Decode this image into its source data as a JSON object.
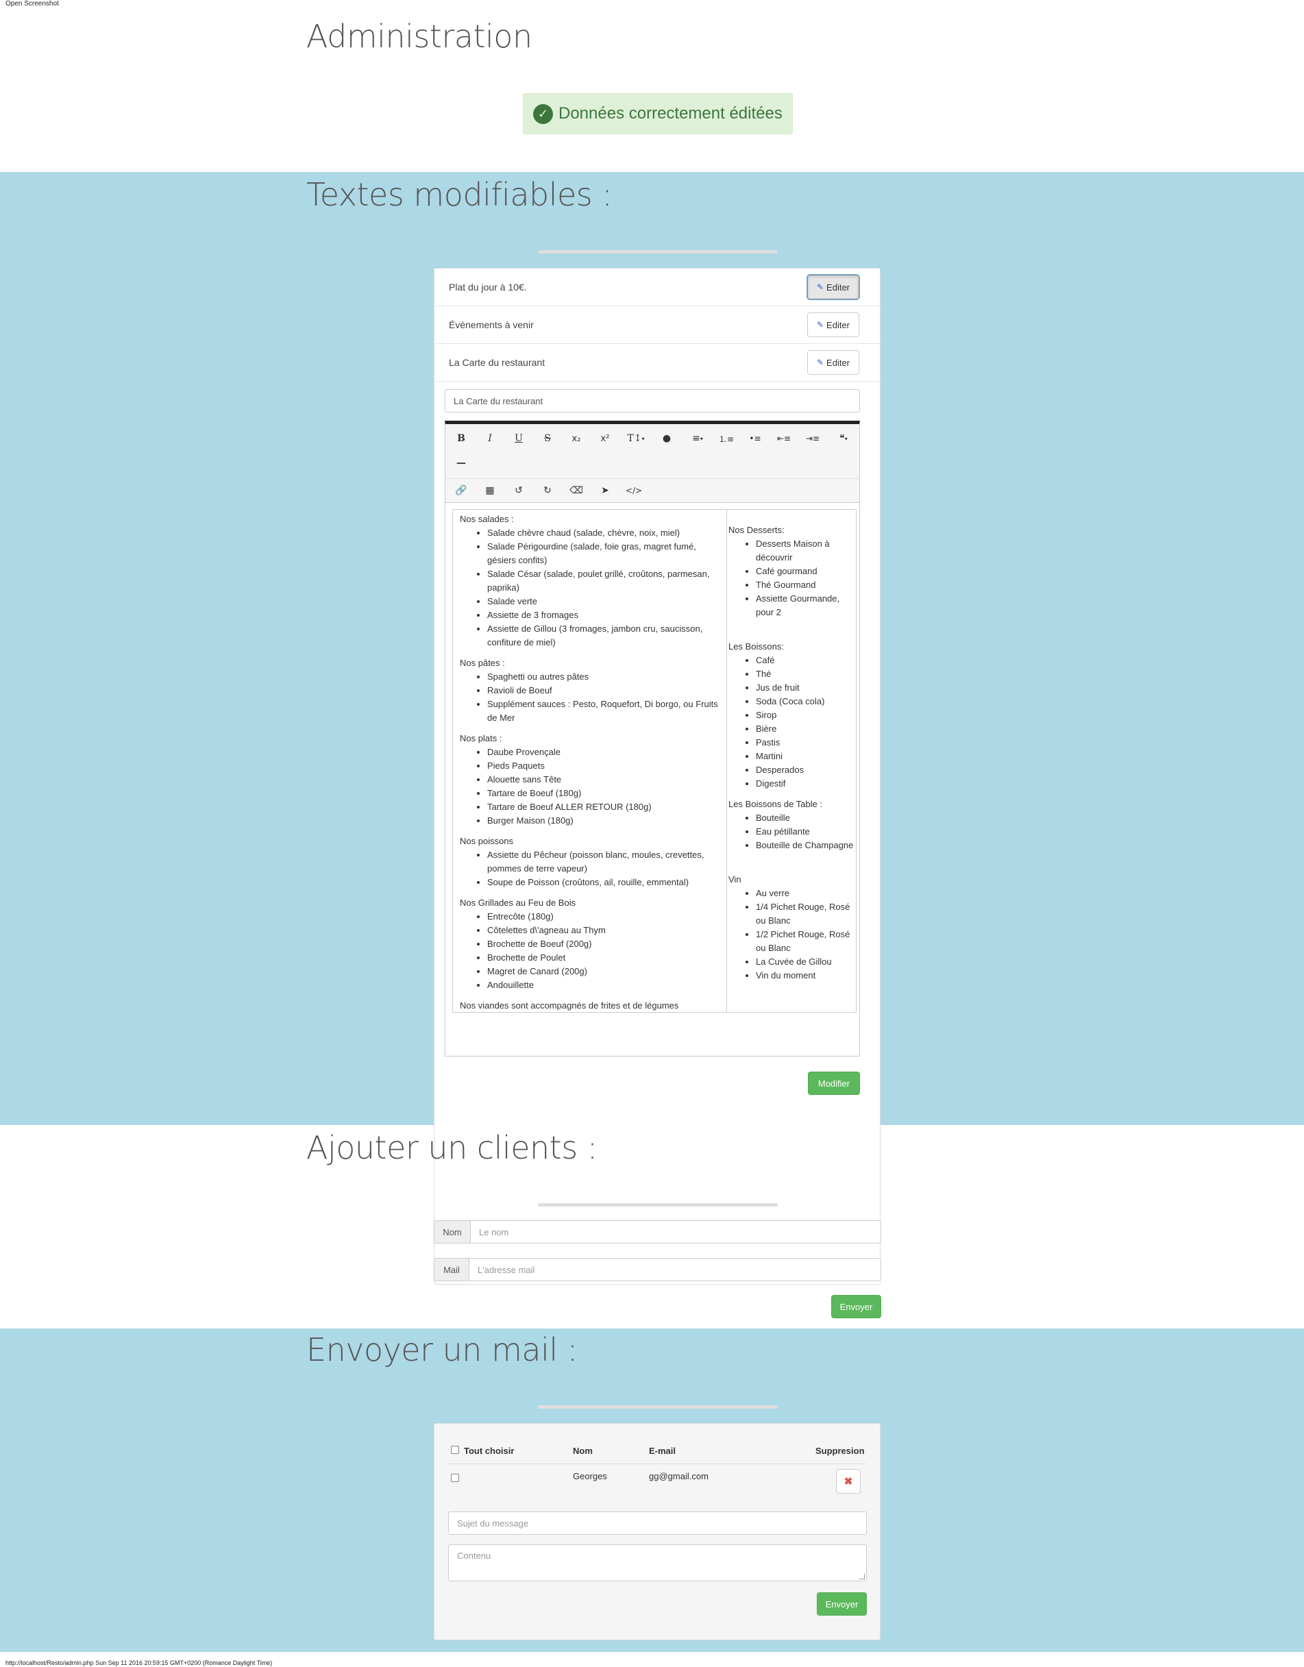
{
  "window": {
    "screenshot_label": "Open Screenshot",
    "footer_url": "http://localhost/Resto/admin.php Sun Sep 11 2016 20:59:15 GMT+0200 (Romance Daylight Time)"
  },
  "header": {
    "title": "Administration"
  },
  "alert": {
    "message": "Données correctement éditées",
    "color": "#3c763d"
  },
  "texts_section": {
    "title": "Textes modifiables :",
    "items": [
      {
        "label": "Plat du jour à 10€.",
        "button": "Editer"
      },
      {
        "label": "Évènements à venir",
        "button": "Editer"
      },
      {
        "label": "La Carte du restaurant",
        "button": "Editer"
      }
    ],
    "title_input_value": "La Carte du restaurant",
    "toolbar": {
      "bold": "B",
      "italic": "I",
      "underline": "U",
      "strike": "S",
      "subscript": "x₂",
      "superscript": "x²",
      "fontsize": "T↕",
      "quote": "❝"
    },
    "menu": {
      "left": [
        {
          "heading": "Nos salades :",
          "items": [
            "Salade chèvre chaud (salade, chèvre, noix, miel)",
            "Salade Périgourdine (salade, foie gras, magret fumé, gésiers confits)",
            "Salade César (salade, poulet grillé, croûtons, parmesan, paprika)",
            "Salade verte",
            "Assiette de 3 fromages",
            "Assiette de Gillou (3 fromages, jambon cru, saucisson, confiture de miel)"
          ]
        },
        {
          "heading": "Nos pâtes :",
          "items": [
            "Spaghetti ou autres pâtes",
            "Ravioli de Boeuf",
            "Supplément sauces : Pesto, Roquefort, Di borgo, ou Fruits de Mer"
          ]
        },
        {
          "heading": "Nos plats :",
          "items": [
            "Daube Provençale",
            "Pieds Paquets",
            "Alouette sans Tête",
            "Tartare de Boeuf (180g)",
            "Tartare de Boeuf ALLER RETOUR (180g)",
            "Burger Maison (180g)"
          ]
        },
        {
          "heading": "Nos poissons",
          "items": [
            "Assiette du Pêcheur (poisson blanc, moules, crevettes, pommes de terre vapeur)",
            "Soupe de Poisson (croûtons, ail, rouille, emmental)"
          ]
        },
        {
          "heading": "Nos Grillades au Feu de Bois",
          "items": [
            "Entrecôte (180g)",
            "Côtelettes d\\'agneau au Thym",
            "Brochette de Boeuf (200g)",
            "Brochette de Poulet",
            "Magret de Canard (200g)",
            "Andouillette"
          ]
        }
      ],
      "left_footer": "Nos viandes sont accompagnés de frites et de légumes",
      "right": [
        {
          "heading": "Nos Desserts:",
          "items": [
            "Desserts Maison à découvrir",
            "Café gourmand",
            "Thé Gourmand",
            "Assiette Gourmande, pour 2"
          ]
        },
        {
          "heading": "Les Boissons:",
          "items": [
            "Café",
            "Thé",
            "Jus de fruit",
            "Soda (Coca cola)",
            "Sirop",
            "Bière",
            "Pastis",
            "Martini",
            "Desperados",
            "Digestif"
          ]
        },
        {
          "heading": "Les Boissons de Table :",
          "items": [
            "Bouteille",
            "Eau pétillante",
            "Bouteille de Champagne"
          ]
        },
        {
          "heading": "Vin",
          "items": [
            "Au verre",
            "1/4 Pichet Rouge, Rosé ou Blanc",
            "1/2 Pichet Rouge, Rosé ou Blanc",
            "La Cuvée de Gillou",
            "Vin du moment"
          ]
        }
      ]
    },
    "submit": "Modifier"
  },
  "clients_section": {
    "title": "Ajouter un clients :",
    "name_label": "Nom",
    "name_placeholder": "Le nom",
    "mail_label": "Mail",
    "mail_placeholder": "L'adresse mail",
    "submit": "Envoyer"
  },
  "mail_section": {
    "title": "Envoyer un mail :",
    "columns": {
      "select_all": "Tout choisir",
      "name": "Nom",
      "email": "E-mail",
      "delete": "Suppresion"
    },
    "rows": [
      {
        "name": "Georges",
        "email": "gg@gmail.com"
      }
    ],
    "subject_placeholder": "Sujet du message",
    "content_placeholder": "Contenu",
    "submit": "Envoyer"
  },
  "colors": {
    "band": "#add8e6",
    "success": "#5cb85c"
  }
}
